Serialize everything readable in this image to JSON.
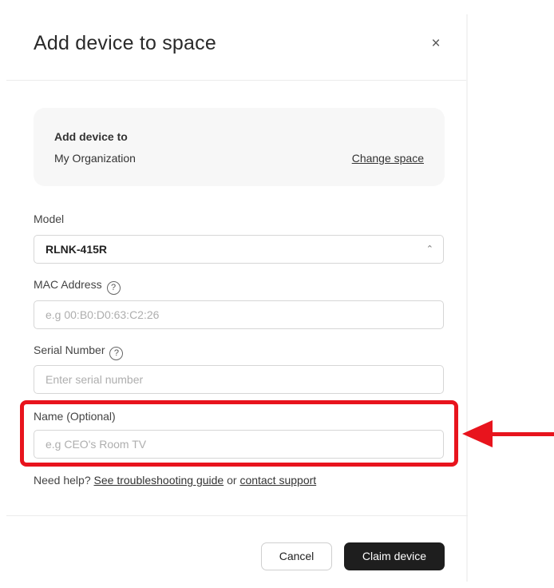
{
  "modal": {
    "title": "Add device to space",
    "close_glyph": "×"
  },
  "space": {
    "label": "Add device to",
    "value": "My Organization",
    "change_link": "Change space"
  },
  "fields": {
    "model": {
      "label": "Model",
      "value": "RLNK-415R"
    },
    "mac": {
      "label": "MAC Address",
      "placeholder": "e.g  00:B0:D0:63:C2:26"
    },
    "serial": {
      "label": "Serial Number",
      "placeholder": "Enter serial number"
    },
    "name": {
      "label": "Name (Optional)",
      "placeholder": "e.g CEO's Room TV"
    }
  },
  "help": {
    "prefix": "Need help?",
    "guide_link": "See troubleshooting guide",
    "middle": "or",
    "support_link": "contact support"
  },
  "footer": {
    "cancel_label": "Cancel",
    "claim_label": "Claim device"
  },
  "colors": {
    "highlight": "#e8141d",
    "primary_button": "#1e1e1e"
  },
  "icons": {
    "help": "question-circle-icon",
    "select": "chevron-up-down-icon",
    "close": "close-icon",
    "annotation": "red-arrow"
  }
}
